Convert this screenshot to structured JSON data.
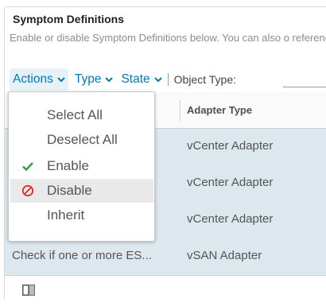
{
  "panel": {
    "title": "Symptom Definitions",
    "description": "Enable or disable Symptom Definitions below. You can also o reference."
  },
  "toolbar": {
    "actions_label": "Actions",
    "type_label": "Type",
    "state_label": "State",
    "object_type_label": "Object Type:",
    "object_type_value": ""
  },
  "grid": {
    "columns": [
      "",
      "Adapter Type"
    ],
    "rows": [
      {
        "name": "",
        "adapter_type": "vCenter Adapter"
      },
      {
        "name": "",
        "adapter_type": "vCenter Adapter"
      },
      {
        "name": "",
        "adapter_type": "vCenter Adapter"
      },
      {
        "name": "Check if one or more ES...",
        "adapter_type": "vSAN Adapter"
      }
    ]
  },
  "actions_menu": {
    "items": [
      {
        "label": "Select All",
        "icon": ""
      },
      {
        "label": "Deselect All",
        "icon": ""
      },
      {
        "label": "Enable",
        "icon": "check-icon"
      },
      {
        "label": "Disable",
        "icon": "ban-icon"
      },
      {
        "label": "Inherit",
        "icon": ""
      }
    ],
    "hovered": "Disable"
  },
  "colors": {
    "accent": "#0079b8",
    "enable_green": "#2e9e3e",
    "disable_red": "#e02b2b",
    "row_selected": "#dde7ee"
  }
}
